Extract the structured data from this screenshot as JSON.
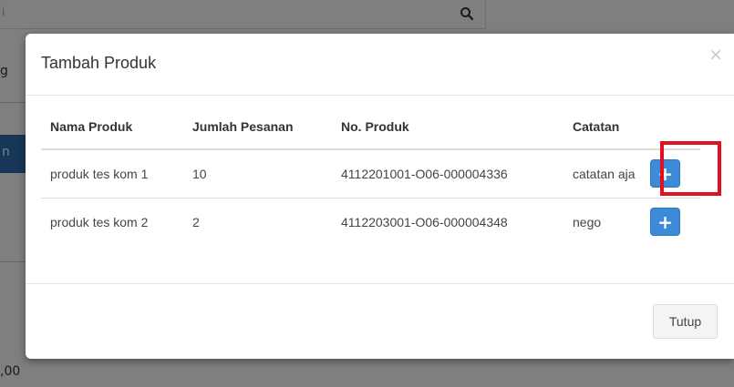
{
  "background": {
    "search_fragment": "i",
    "left_fragment_top": "g",
    "left_fragment_blue": "n",
    "bottom_value": ",00"
  },
  "modal": {
    "title": "Tambah Produk",
    "close_symbol": "×",
    "columns": [
      "Nama Produk",
      "Jumlah Pesanan",
      "No. Produk",
      "Catatan"
    ],
    "rows": [
      {
        "name": "produk tes kom 1",
        "qty": "10",
        "number": "4112201001-O06-000004336",
        "note": "catatan aja",
        "action": "+"
      },
      {
        "name": "produk tes kom 2",
        "qty": "2",
        "number": "4112203001-O06-000004348",
        "note": "nego",
        "action": "+"
      }
    ],
    "footer_button": "Tutup"
  },
  "colors": {
    "primary_button": "#3d8bd8",
    "highlight_border": "#e0101e",
    "overlay": "#7d7d7d"
  }
}
